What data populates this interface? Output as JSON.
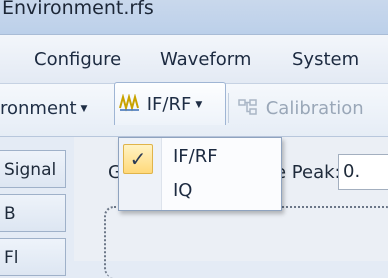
{
  "window": {
    "title": "Environment.rfs"
  },
  "menu": {
    "items": [
      "Configure",
      "Waveform",
      "System"
    ]
  },
  "toolbar": {
    "environment_label": "ronment",
    "ifrf_label": "IF/RF",
    "calibration_label": "Calibration"
  },
  "side_tabs": [
    "Signal",
    "B",
    "Fl"
  ],
  "main": {
    "g_label": "G",
    "peak_label": "e Peak:",
    "peak_value": "0."
  },
  "dropdown": {
    "check": "✓",
    "items": [
      "IF/RF",
      "IQ"
    ],
    "selected": "IF/RF"
  },
  "colors": {
    "accent": "#ffd97a",
    "ribbon": "#e4ebf5"
  }
}
